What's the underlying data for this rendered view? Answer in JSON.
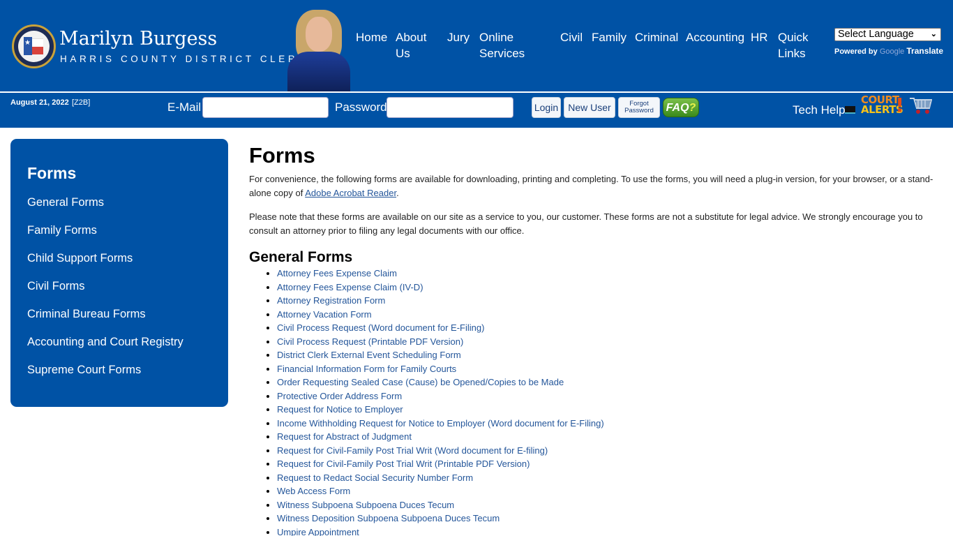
{
  "header": {
    "brand_name": "Marilyn Burgess",
    "brand_subtitle": "HARRIS COUNTY DISTRICT CLERK",
    "nav": [
      {
        "label": "Home"
      },
      {
        "label": "About Us"
      },
      {
        "label": "Jury"
      },
      {
        "label": "Online Services"
      },
      {
        "label": "Civil"
      },
      {
        "label": "Family"
      },
      {
        "label": "Criminal"
      },
      {
        "label": "Accounting"
      },
      {
        "label": "HR"
      },
      {
        "label": "Quick Links"
      }
    ],
    "language_select": {
      "selected": "Select Language"
    },
    "powered_by": "Powered by",
    "google": "Google",
    "translate": "Translate"
  },
  "subbar": {
    "date": "August 21, 2022",
    "code": "[Z2B]",
    "email_label": "E-Mail",
    "email_value": "",
    "password_label": "Password",
    "password_value": "",
    "login_label": "Login",
    "new_user_label": "New User",
    "forgot_line1": "Forgot",
    "forgot_line2": "Password",
    "faq_label": "FAQ",
    "faq_mark": "?",
    "tech_help_label": "Tech Help",
    "court_alerts_line1": "COURT",
    "court_alerts_line2": "ALERTS",
    "court_alerts_mark": "!"
  },
  "sidebar": {
    "title": "Forms",
    "items": [
      {
        "label": "General Forms"
      },
      {
        "label": "Family Forms"
      },
      {
        "label": "Child Support Forms"
      },
      {
        "label": "Civil Forms"
      },
      {
        "label": "Criminal Bureau Forms"
      },
      {
        "label": "Accounting and Court Registry"
      },
      {
        "label": "Supreme Court Forms"
      }
    ]
  },
  "main": {
    "title": "Forms",
    "intro_before_link": "For convenience, the following forms are available for downloading, printing and completing. To use the forms, you will need a plug-in version, for your browser, or a stand-alone copy of ",
    "intro_link": "Adobe Acrobat Reader",
    "intro_after_link": ".",
    "notice": "Please note that these forms are available on our site as a service to you, our customer. These forms are not a substitute for legal advice. We strongly encourage you to consult an attorney prior to filing any legal documents with our office.",
    "section_title": "General Forms",
    "forms": [
      "Attorney Fees Expense Claim",
      "Attorney Fees Expense Claim (IV-D)",
      "Attorney Registration Form",
      "Attorney Vacation Form",
      "Civil Process Request (Word document for E-Filing)",
      "Civil Process Request (Printable PDF Version)",
      "District Clerk External Event Scheduling Form",
      "Financial Information Form for Family Courts",
      "Order Requesting Sealed Case (Cause) be Opened/Copies to be Made",
      "Protective Order Address Form",
      "Request for Notice to Employer",
      "Income Withholding Request for Notice to Employer (Word document for E-Filing)",
      "Request for Abstract of Judgment",
      "Request for Civil-Family Post Trial Writ (Word document for E-filing)",
      "Request for Civil-Family Post Trial Writ (Printable PDF Version)",
      "Request to Redact Social Security Number Form",
      "Web Access Form",
      "Witness Subpoena Subpoena Duces Tecum",
      "Witness Deposition Subpoena Subpoena Duces Tecum",
      "Umpire Appointment"
    ]
  },
  "colors": {
    "brand_blue": "#0052a5",
    "link_blue": "#24569a",
    "faq_green": "#4a9a28"
  }
}
